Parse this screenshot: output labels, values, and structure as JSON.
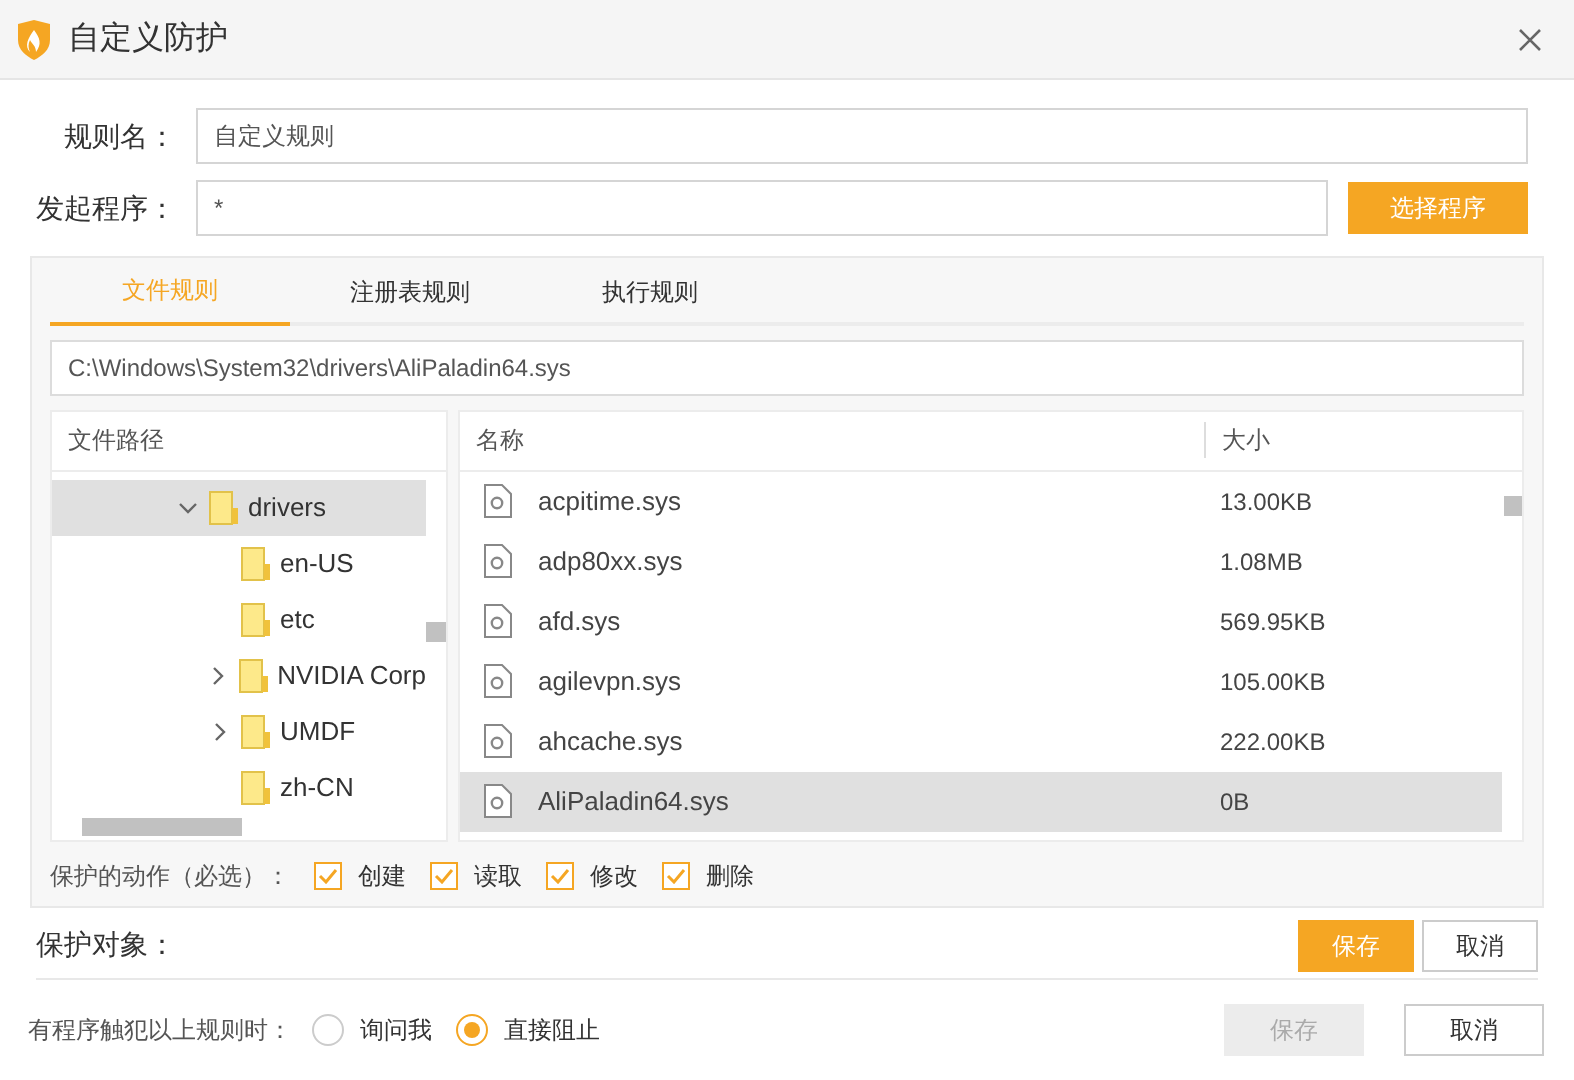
{
  "window": {
    "title": "自定义防护"
  },
  "rule_name": {
    "label": "规则名：",
    "value": "自定义规则"
  },
  "launcher": {
    "label": "发起程序：",
    "value": "*",
    "button": "选择程序"
  },
  "tabs": [
    {
      "label": "文件规则",
      "selected": true
    },
    {
      "label": "注册表规则",
      "selected": false
    },
    {
      "label": "执行规则",
      "selected": false
    }
  ],
  "path_field": {
    "value": "C:\\Windows\\System32\\drivers\\AliPaladin64.sys"
  },
  "tree": {
    "header": "文件路径",
    "items": [
      {
        "label": "drivers",
        "expanded": true,
        "selected": true,
        "children": [
          {
            "label": "en-US",
            "selected": false
          },
          {
            "label": "etc",
            "selected": false
          },
          {
            "label": "NVIDIA Corp",
            "expanded": false,
            "selected": false
          },
          {
            "label": "UMDF",
            "expanded": false,
            "selected": false
          },
          {
            "label": "zh-CN",
            "selected": false
          }
        ]
      }
    ]
  },
  "files": {
    "columns": [
      "名称",
      "大小"
    ],
    "rows": [
      {
        "name": "acpitime.sys",
        "size": "13.00KB",
        "selected": false
      },
      {
        "name": "adp80xx.sys",
        "size": "1.08MB",
        "selected": false
      },
      {
        "name": "afd.sys",
        "size": "569.95KB",
        "selected": false
      },
      {
        "name": "agilevpn.sys",
        "size": "105.00KB",
        "selected": false
      },
      {
        "name": "ahcache.sys",
        "size": "222.00KB",
        "selected": false
      },
      {
        "name": "AliPaladin64.sys",
        "size": "0B",
        "selected": true
      }
    ]
  },
  "actions": {
    "label": "保护的动作（必选）：",
    "items": [
      {
        "label": "创建",
        "checked": true
      },
      {
        "label": "读取",
        "checked": true
      },
      {
        "label": "修改",
        "checked": true
      },
      {
        "label": "删除",
        "checked": true
      }
    ]
  },
  "protect_target": {
    "label": "保护对象：",
    "save": "保存",
    "cancel": "取消"
  },
  "violation": {
    "label": "有程序触犯以上规则时：",
    "options": [
      {
        "label": "询问我",
        "selected": false
      },
      {
        "label": "直接阻止",
        "selected": true
      }
    ]
  },
  "footer": {
    "save": {
      "label": "保存",
      "disabled": true
    },
    "cancel": "取消"
  }
}
